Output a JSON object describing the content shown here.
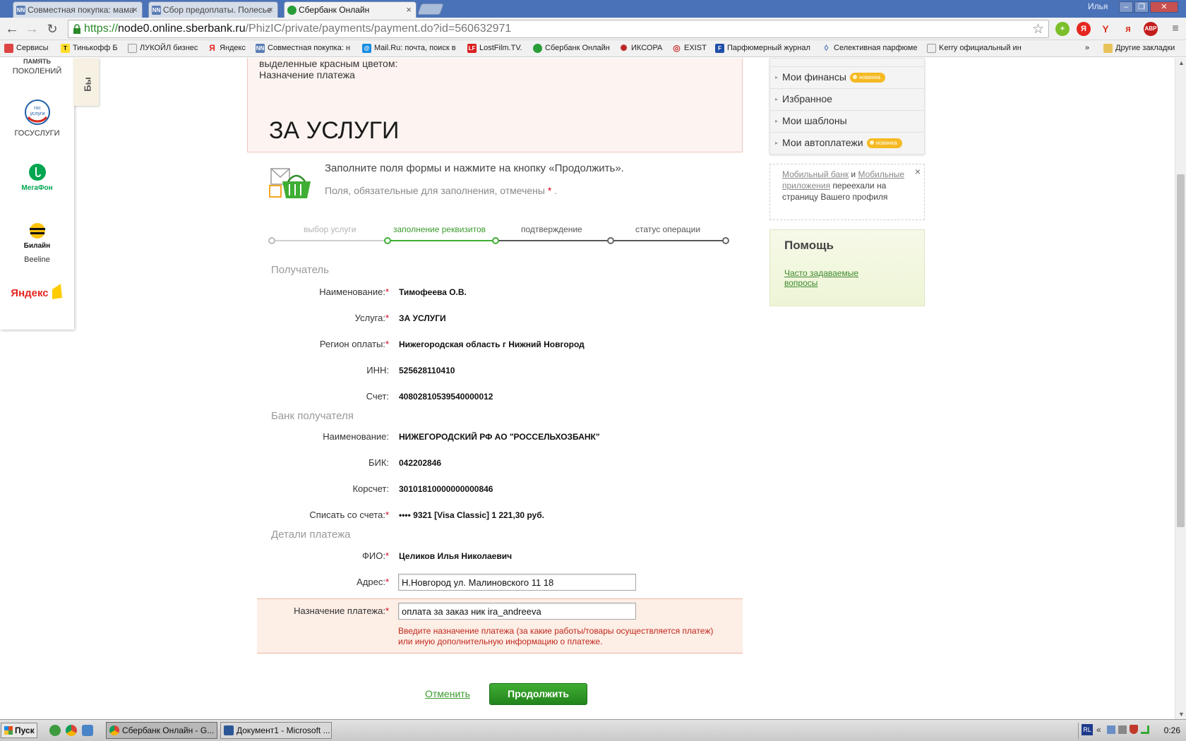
{
  "browser": {
    "tabs": [
      {
        "title": "Совместная покупка: мама",
        "favicon": "NN"
      },
      {
        "title": "Сбор предоплаты. Полесье",
        "favicon": "NN"
      },
      {
        "title": "Сбербанк Онлайн",
        "favicon": "sber"
      }
    ],
    "window_user": "Илья",
    "url_scheme": "https://",
    "url_host": "node0.online.sberbank.ru",
    "url_path": "/PhizIC/private/payments/payment.do?id=560632971",
    "bookmarks": [
      "Сервисы",
      "Тинькофф Б",
      "ЛУКОЙЛ бизнес",
      "Яндекс",
      "Совместная покупка: н",
      "Mail.Ru: почта, поиск в",
      "LostFilm.TV.",
      "Сбербанк Онлайн",
      "ИКСОРА",
      "EXIST",
      "Парфюмерный журнал",
      "Селективная парфюме",
      "Kerry официальный ин"
    ],
    "other_bookmarks": "Другие закладки",
    "more_bookmarks": "»"
  },
  "promo": {
    "tab_label": "Бы",
    "items": [
      {
        "label": "ПАМЯТЬ",
        "label2": "ПОКОЛЕНИЙ"
      },
      {
        "label": "ГОСУСЛУГИ",
        "logo_text": "гос услуги"
      },
      {
        "label": "",
        "logo_text": "МегаФон"
      },
      {
        "label": "Beeline",
        "logo_text": "Билайн"
      },
      {
        "label": "",
        "logo_text": "Яндекс"
      }
    ]
  },
  "warning": {
    "line1": "выделенные красным цветом:",
    "line2": "Назначение платежа"
  },
  "page": {
    "title": "ЗА УСЛУГИ",
    "intro": "Заполните поля формы и нажмите на кнопку «Продолжить».",
    "required_note": "Поля, обязательные для заполнения, отмечены",
    "required_mark": "*",
    "required_end": "."
  },
  "steps": [
    {
      "label": "выбор услуги",
      "state": "done"
    },
    {
      "label": "заполнение реквизитов",
      "state": "current"
    },
    {
      "label": "подтверждение",
      "state": "todo"
    },
    {
      "label": "статус операции",
      "state": "todo"
    }
  ],
  "form": {
    "recipient_title": "Получатель",
    "name_label": "Наименование:",
    "name_value": "Тимофеева О.В.",
    "service_label": "Услуга:",
    "service_value": "ЗА УСЛУГИ",
    "region_label": "Регион оплаты:",
    "region_value": "Нижегородская область г Нижний Новгород",
    "inn_label": "ИНН:",
    "inn_value": "525628110410",
    "account_label": "Счет:",
    "account_value": "40802810539540000012",
    "bank_title": "Банк получателя",
    "bank_name_label": "Наименование:",
    "bank_name_value": "НИЖЕГОРОДСКИЙ РФ АО \"РОССЕЛЬХОЗБАНК\"",
    "bik_label": "БИК:",
    "bik_value": "042202846",
    "korr_label": "Корсчет:",
    "korr_value": "30101810000000000846",
    "from_label": "Списать со счета:",
    "from_value": "•••• 9321  [Visa Classic] 1 221,30   руб.",
    "details_title": "Детали платежа",
    "fio_label": "ФИО:",
    "fio_value": "Целиков Илья Николаевич",
    "address_label": "Адрес:",
    "address_value": "Н.Новгород ул. Малиновского 11 18",
    "purpose_label": "Назначение платежа:",
    "purpose_value": "оплата за заказ ник ira_andreeva",
    "purpose_error": "Введите назначение платежа (за какие работы/товары осуществляется платеж) или иную дополнительную информацию о платеже.",
    "required_mark": "*"
  },
  "actions": {
    "cancel": "Отменить",
    "continue": "Продолжить"
  },
  "sidebar": {
    "menu": [
      {
        "label": "Мои финансы",
        "badge": "новинка"
      },
      {
        "label": "Избранное",
        "badge": ""
      },
      {
        "label": "Мои шаблоны",
        "badge": ""
      },
      {
        "label": "Мои автоплатежи",
        "badge": "новинка"
      }
    ],
    "notice_link1": "Мобильный банк",
    "notice_and": "и",
    "notice_link2": "Мобильные приложения",
    "notice_text": "переехали на страницу Вашего профиля",
    "notice_close": "×",
    "help_title": "Помощь",
    "help_link": "Часто задаваемые вопросы"
  },
  "taskbar": {
    "start": "Пуск",
    "tasks": [
      {
        "label": "Сбербанк Онлайн - G...",
        "active": true
      },
      {
        "label": "Документ1 - Microsoft ...",
        "active": false
      }
    ],
    "lang": "RL",
    "tray_arrows": "«",
    "clock": "0:26"
  },
  "colors": {
    "brand_green": "#3d9a2f",
    "error_red": "#c0281b",
    "badge_orange": "#f5b922",
    "chrome_blue": "#4a72b8"
  }
}
